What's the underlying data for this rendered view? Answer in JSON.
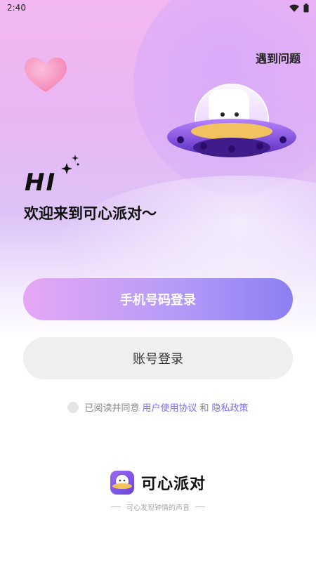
{
  "status_bar": {
    "time": "2:40",
    "icons": [
      "wifi-icon",
      "battery-icon"
    ]
  },
  "header": {
    "help_label": "遇到问题"
  },
  "hero": {
    "greeting": "HI",
    "welcome_text": "欢迎来到可心派对～"
  },
  "buttons": {
    "phone_login": "手机号码登录",
    "account_login": "账号登录"
  },
  "agreement": {
    "prefix": "已阅读并同意",
    "user_agreement": "用户使用协议",
    "joiner": "和",
    "privacy_policy": "隐私政策"
  },
  "brand": {
    "name": "可心派对",
    "tagline": "可心发现钟情的声音"
  },
  "colors": {
    "accent_link": "#7a6ff0",
    "primary_button_start": "#e6a7f4",
    "primary_button_end": "#8c7ff2",
    "secondary_button": "#efefef"
  }
}
